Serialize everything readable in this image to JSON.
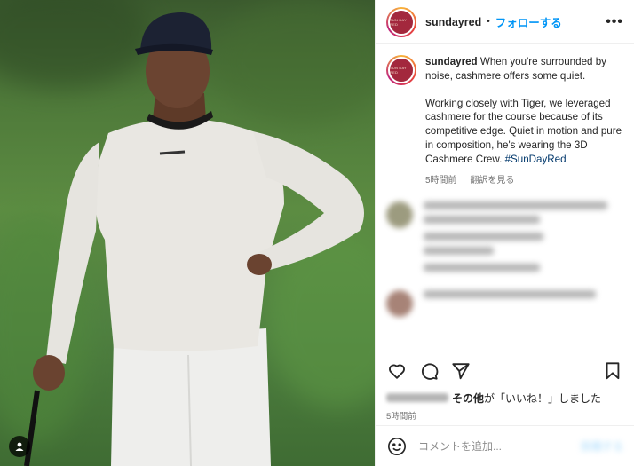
{
  "post": {
    "username": "sundayred",
    "follow_label": "フォローする",
    "separator": "•",
    "more_label": "•••",
    "avatar_text": "SUN DAY RED"
  },
  "caption": {
    "username": "sundayred",
    "text_part1": "When you're surrounded by noise, cashmere offers some quiet.",
    "text_part2": "Working closely with Tiger, we leveraged cashmere for the course because of its competitive edge. Quiet in motion and pure in composition, he's wearing the 3D Cashmere Crew.",
    "hashtag": "#SunDayRed",
    "time": "5時間前",
    "translate_label": "翻訳を見る"
  },
  "likes": {
    "text_bold": "その他",
    "text_rest": "が「いいね！」しました"
  },
  "timestamp": "5時間前",
  "add_comment": {
    "placeholder": "コメントを追加...",
    "post_label": "投稿する"
  },
  "icons": {
    "like": "heart-icon",
    "comment": "comment-icon",
    "share": "send-icon",
    "save": "bookmark-icon",
    "emoji": "smiley-icon",
    "tag": "user-tag-icon"
  },
  "colors": {
    "accent": "#0095f6",
    "link": "#00376b",
    "muted": "#737373",
    "brand": "#a3283d"
  }
}
